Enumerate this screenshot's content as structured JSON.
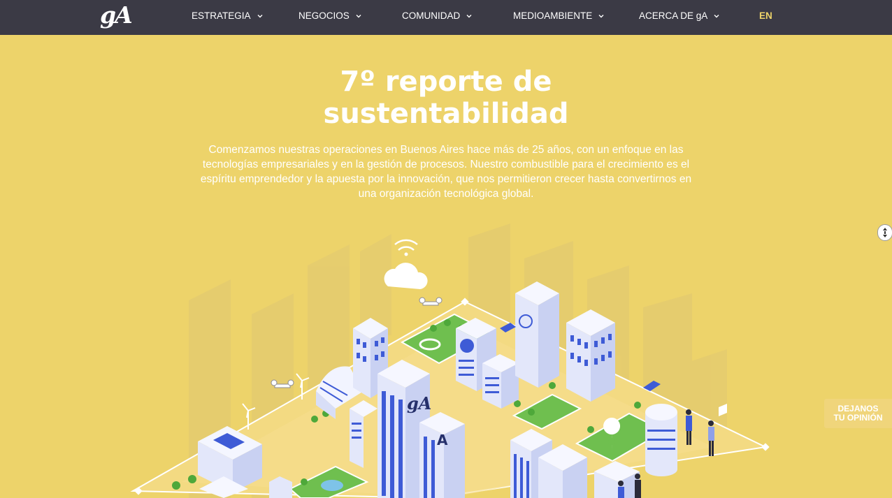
{
  "brand": {
    "logo_text": "gA"
  },
  "nav": {
    "items": [
      {
        "label": "ESTRATEGIA"
      },
      {
        "label": "NEGOCIOS"
      },
      {
        "label": "COMUNIDAD"
      },
      {
        "label": "MEDIOAMBIENTE"
      },
      {
        "label": "ACERCA DE gA"
      }
    ],
    "lang_label": "EN"
  },
  "hero": {
    "title_line1": "7º reporte de",
    "title_line2": "sustentabilidad",
    "paragraph": "Comenzamos nuestras operaciones en Buenos Aires hace más de 25 años, con un enfoque en las tecnologías empresariales y en la gestión de procesos. Nuestro combustible para el crecimiento es el espíritu emprendedor y la apuesta por la innovación, que nos permitieron crecer hasta convertirnos en una organización tecnológica global."
  },
  "illustration": {
    "building_logo_main": "gA",
    "building_logo_side": "A"
  },
  "feedback": {
    "line1": "DEJANOS",
    "line2": "TU OPINIÓN"
  },
  "colors": {
    "background": "#EDD36A",
    "nav_bg": "#3B3A45",
    "accent": "#EDD36A",
    "building_blue": "#3E5BD6"
  },
  "icons": {
    "nav_dropdown": "chevron-down-icon",
    "scroll": "scroll-arrows-icon"
  }
}
